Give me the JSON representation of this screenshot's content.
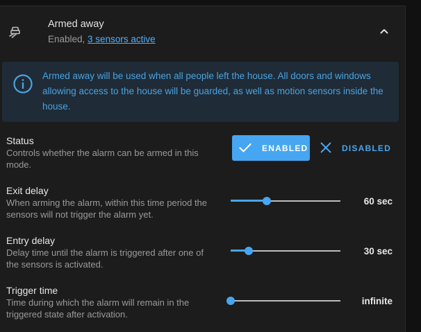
{
  "header": {
    "icon": "car-leaving-icon",
    "title": "Armed away",
    "subtitle_prefix": "Enabled, ",
    "subtitle_link": "3 sensors active"
  },
  "info": {
    "icon": "info-circle-icon",
    "text": "Armed away will be used when all people left the house. All doors and windows allowing access to the house will be guarded, as well as motion sensors inside the house."
  },
  "status": {
    "label": "Status",
    "description": "Controls whether the alarm can be armed in this mode.",
    "enabled_label": "ENABLED",
    "disabled_label": "DISABLED",
    "selected": "enabled"
  },
  "settings": [
    {
      "label": "Exit delay",
      "description": "When arming the alarm, within this time period the sensors will not trigger the alarm yet.",
      "value": "60 sec",
      "level": 0.33
    },
    {
      "label": "Entry delay",
      "description": "Delay time until the alarm is triggered after one of the sensors is activated.",
      "value": "30 sec",
      "level": 0.165
    },
    {
      "label": "Trigger time",
      "description": "Time during which the alarm will remain in the triggered state after activation.",
      "value": "infinite",
      "level": 0
    }
  ],
  "colors": {
    "accent": "#46a6f1",
    "info_background": "#1f2b37",
    "info_text": "#4aa3df",
    "card_background": "#1c1c1c"
  }
}
